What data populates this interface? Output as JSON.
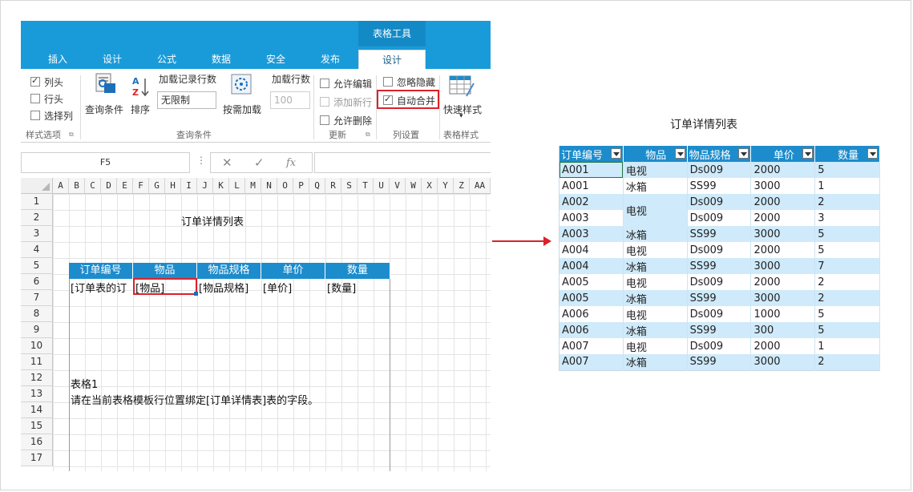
{
  "ribbon": {
    "context_tab": "表格工具",
    "tabs": [
      "插入",
      "设计",
      "公式",
      "数据",
      "安全",
      "发布",
      "设计"
    ],
    "style_options": {
      "items": [
        {
          "label": "列头",
          "checked": true
        },
        {
          "label": "行头",
          "checked": false
        },
        {
          "label": "选择列",
          "checked": false
        }
      ],
      "group_label": "样式选项"
    },
    "query": {
      "query_cond_label": "查询条件",
      "sort_label": "排序",
      "load_rows_label": "加载记录行数",
      "load_rows_value": "无限制",
      "on_demand_label": "按需加载",
      "load_count_label": "加载行数",
      "load_count_value": "100",
      "group_label": "查询条件"
    },
    "update": {
      "items": [
        {
          "label": "允许编辑",
          "checked": false,
          "disabled": false
        },
        {
          "label": "添加新行",
          "checked": false,
          "disabled": true
        },
        {
          "label": "允许删除",
          "checked": false,
          "disabled": false
        }
      ],
      "group_label": "更新"
    },
    "column_settings": {
      "items": [
        {
          "label": "忽略隐藏",
          "checked": false
        },
        {
          "label": "自动合并",
          "checked": true
        }
      ],
      "group_label": "列设置"
    },
    "table_style": {
      "quick_style_label": "快速样式",
      "group_label": "表格样式"
    }
  },
  "formula_bar": {
    "name_box": "F5",
    "dots": "⋮",
    "cancel": "✕",
    "confirm": "✓",
    "fx": "fx"
  },
  "sheet": {
    "columns": [
      "A",
      "B",
      "C",
      "D",
      "E",
      "F",
      "G",
      "H",
      "I",
      "J",
      "K",
      "L",
      "M",
      "N",
      "O",
      "P",
      "Q",
      "R",
      "S",
      "T",
      "U",
      "V",
      "W",
      "X",
      "Y",
      "Z",
      "AA"
    ],
    "rows": [
      "1",
      "2",
      "3",
      "4",
      "5",
      "6",
      "7",
      "8",
      "9",
      "10",
      "11",
      "12",
      "13",
      "14",
      "15",
      "16",
      "17"
    ],
    "title": "订单详情列表",
    "headers": [
      "订单编号",
      "物品",
      "物品规格",
      "单价",
      "数量"
    ],
    "bindings": [
      "[订单表的订",
      "[物品]",
      "[物品规格]",
      "[单价]",
      "[数量]"
    ],
    "note_line1": "表格1",
    "note_line2": "请在当前表格模板行位置绑定[订单详情表]表的字段。"
  },
  "result": {
    "title": "订单详情列表",
    "headers": [
      "订单编号",
      "物品",
      "物品规格",
      "单价",
      "数量"
    ],
    "rows": [
      {
        "id": "A001",
        "item": "电视",
        "spec": "Ds009",
        "price": "2000",
        "qty": "5"
      },
      {
        "id": "A001",
        "item": "冰箱",
        "spec": "SS99",
        "price": "3000",
        "qty": "1"
      },
      {
        "id": "A002",
        "item": "电视",
        "spec": "Ds009",
        "price": "2000",
        "qty": "2"
      },
      {
        "id": "A003",
        "item": "",
        "spec": "Ds009",
        "price": "2000",
        "qty": "3"
      },
      {
        "id": "A003",
        "item": "冰箱",
        "spec": "SS99",
        "price": "3000",
        "qty": "5"
      },
      {
        "id": "A004",
        "item": "电视",
        "spec": "Ds009",
        "price": "2000",
        "qty": "5"
      },
      {
        "id": "A004",
        "item": "冰箱",
        "spec": "SS99",
        "price": "3000",
        "qty": "7"
      },
      {
        "id": "A005",
        "item": "电视",
        "spec": "Ds009",
        "price": "2000",
        "qty": "2"
      },
      {
        "id": "A005",
        "item": "冰箱",
        "spec": "SS99",
        "price": "3000",
        "qty": "2"
      },
      {
        "id": "A006",
        "item": "电视",
        "spec": "Ds009",
        "price": "1000",
        "qty": "5"
      },
      {
        "id": "A006",
        "item": "冰箱",
        "spec": "SS99",
        "price": "300",
        "qty": "5"
      },
      {
        "id": "A007",
        "item": "电视",
        "spec": "Ds009",
        "price": "2000",
        "qty": "1"
      },
      {
        "id": "A007",
        "item": "冰箱",
        "spec": "SS99",
        "price": "3000",
        "qty": "2"
      }
    ]
  },
  "colors": {
    "ribbon": "#1a9bd9",
    "header": "#1d8ccc",
    "row_alt": "#cfeafa",
    "highlight": "#d9232a"
  }
}
